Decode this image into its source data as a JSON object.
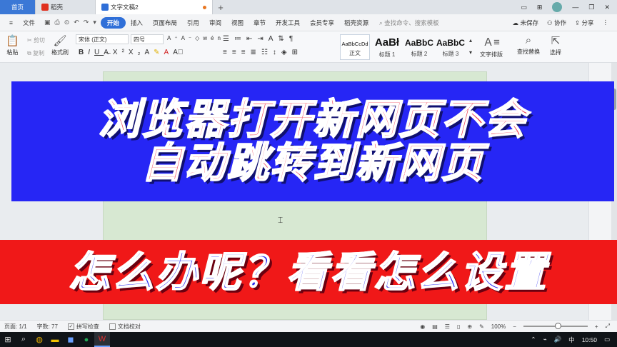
{
  "tabs": {
    "home": "首页",
    "daoke": "稻壳",
    "document": "文字文稿2",
    "new_tab": "+"
  },
  "window_controls": {
    "minimize": "—",
    "maximize": "❐",
    "close": "✕"
  },
  "menu": {
    "file": "文件",
    "items": [
      "开始",
      "插入",
      "页面布局",
      "引用",
      "审阅",
      "视图",
      "章节",
      "开发工具",
      "会员专享",
      "稻壳资源"
    ],
    "search_placeholder": "查找命令、搜索模板",
    "unsaved": "未保存",
    "collaborate": "协作",
    "share": "分享"
  },
  "ribbon": {
    "paste": "粘贴",
    "cut": "剪切",
    "copy": "复制",
    "format_painter": "格式刷",
    "font_name": "宋体 (正文)",
    "font_size": "四号",
    "styles": [
      {
        "sample": "AaBbCcDd",
        "label": "正文"
      },
      {
        "sample": "AaBł",
        "label": "标题 1"
      },
      {
        "sample": "AaBbC",
        "label": "标题 2"
      },
      {
        "sample": "AaBbC",
        "label": "标题 3"
      }
    ],
    "text_layout": "文字排版",
    "find_replace": "查找替换",
    "select": "选择"
  },
  "banners": {
    "line1": "浏览器打开新网页不会",
    "line2": "自动跳转到新网页",
    "line3": "怎么办呢？看看怎么设置"
  },
  "status": {
    "page": "页面: 1/1",
    "word_count": "字数: 77",
    "spell_check": "拼写检查",
    "doc_proof": "文档校对",
    "zoom": "100%",
    "zoom_level": 0.5
  },
  "taskbar": {
    "time": "10:50",
    "ime": "中"
  },
  "colors": {
    "blue_banner": "#2626f5",
    "red_banner": "#f01818",
    "accent": "#2f6fd8"
  }
}
